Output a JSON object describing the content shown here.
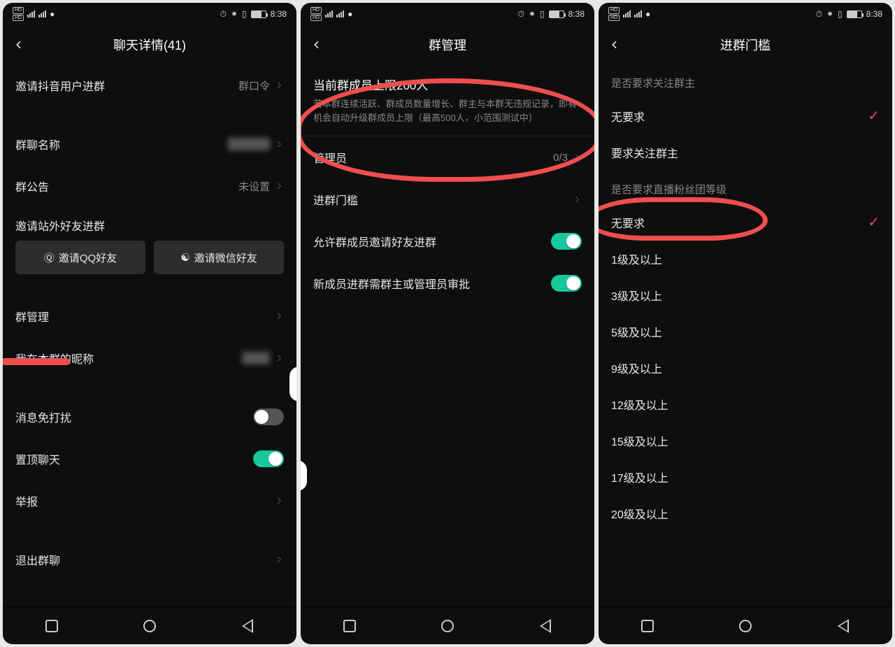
{
  "status": {
    "hd": "HD",
    "net": "4G",
    "time": "8:38",
    "alarm_icon": "⏰",
    "bt_icon": "✱",
    "vib_icon": "📳"
  },
  "phone1": {
    "title": "聊天详情(41)",
    "invite_douyin": "邀请抖音用户进群",
    "group_code": "群口令",
    "group_name_label": "群聊名称",
    "announcement_label": "群公告",
    "announcement_value": "未设置",
    "invite_external_label": "邀请站外好友进群",
    "qq_btn": "邀请QQ好友",
    "wx_btn": "邀请微信好友",
    "manage": "群管理",
    "my_nick": "我在本群的昵称",
    "dnd": "消息免打扰",
    "pin": "置顶聊天",
    "report": "举报",
    "leave": "退出群聊"
  },
  "phone2": {
    "title": "群管理",
    "limit_head": "当前群成员上限200人",
    "limit_desc": "若本群连续活跃、群成员数量增长、群主与本群无违规记录，即有机会自动升级群成员上限（最高500人，小范围测试中）",
    "admins": "管理员",
    "admins_val": "0/3",
    "threshold": "进群门槛",
    "allow_invite": "允许群成员邀请好友进群",
    "need_approval": "新成员进群需群主或管理员审批"
  },
  "phone3": {
    "title": "进群门槛",
    "q1": "是否要求关注群主",
    "opt_none": "无要求",
    "opt_follow": "要求关注群主",
    "q2": "是否要求直播粉丝团等级",
    "levels": [
      "无要求",
      "1级及以上",
      "3级及以上",
      "5级及以上",
      "9级及以上",
      "12级及以上",
      "15级及以上",
      "17级及以上",
      "20级及以上"
    ]
  }
}
